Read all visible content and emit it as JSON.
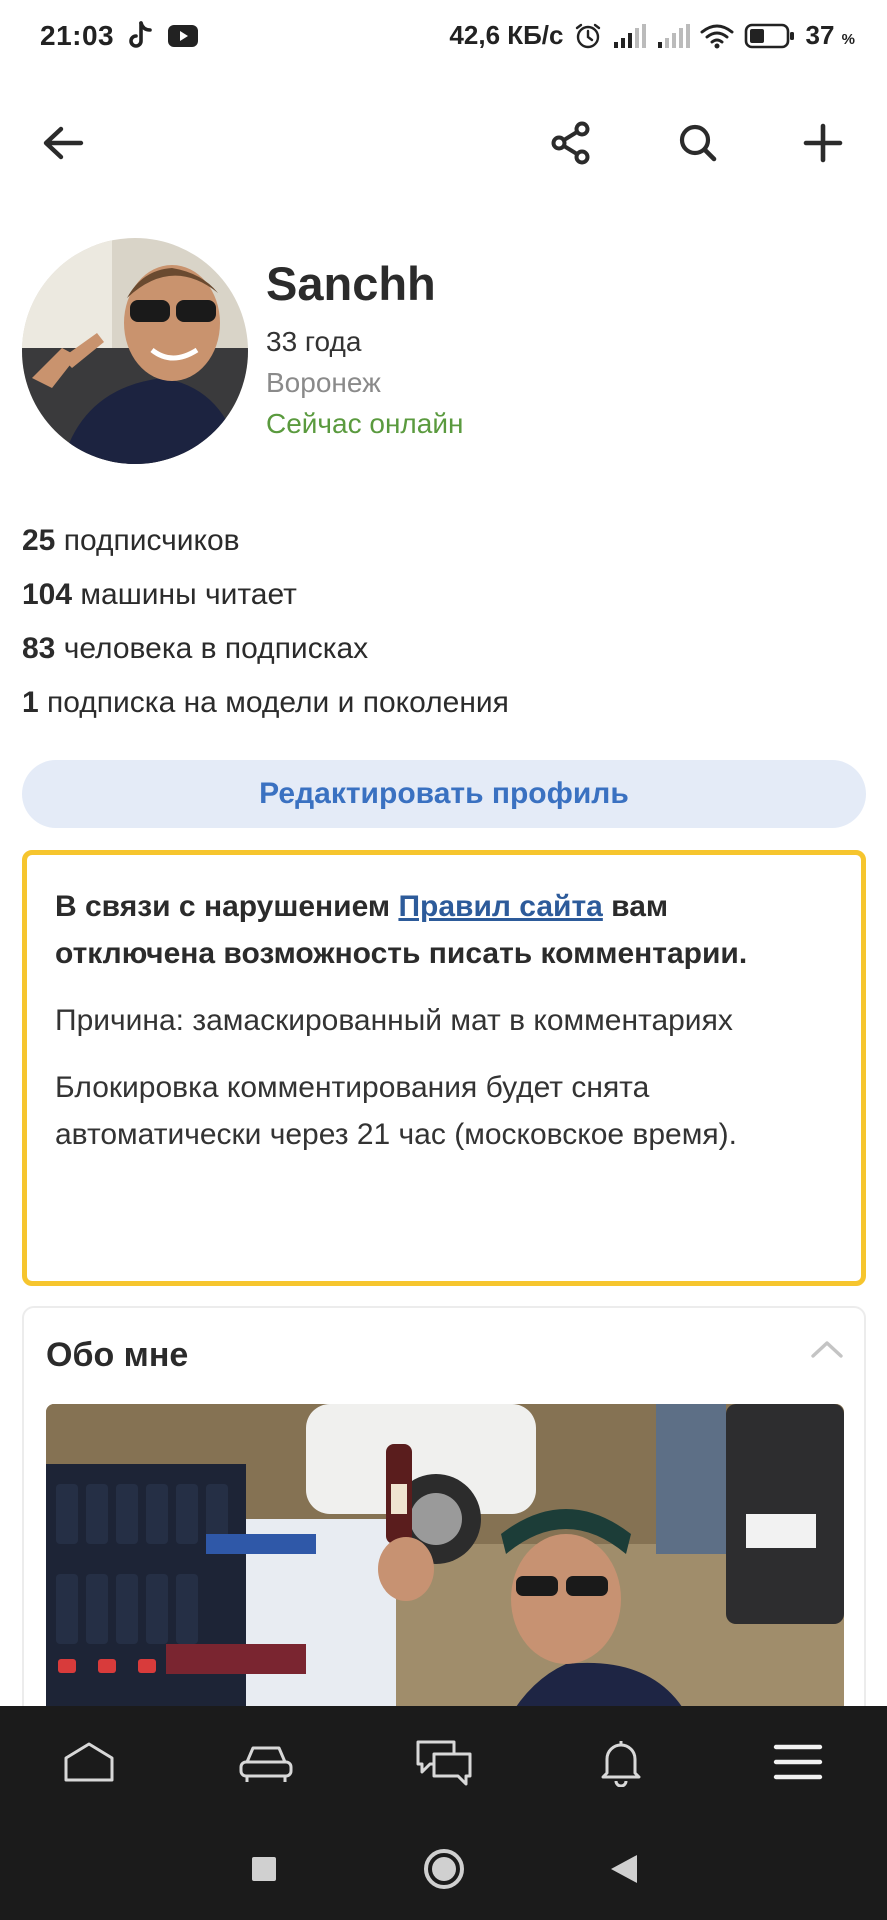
{
  "status_bar": {
    "time": "21:03",
    "net_speed": "42,6 КБ/с",
    "battery_percent": "37",
    "battery_unit": "%",
    "left_icons": [
      "tiktok-icon",
      "youtube-icon"
    ],
    "right_icons": [
      "alarm-icon",
      "signal-1-icon",
      "signal-2-icon",
      "wifi-icon",
      "battery-icon"
    ]
  },
  "app_bar": {
    "icons": [
      "back-arrow-icon",
      "share-icon",
      "search-icon",
      "plus-icon"
    ]
  },
  "profile": {
    "name": "Sanchh",
    "age": "33 года",
    "city": "Воронеж",
    "status": "Сейчас онлайн"
  },
  "stats": [
    {
      "count": "25",
      "label": " подписчиков"
    },
    {
      "count": "104",
      "label": " машины читает"
    },
    {
      "count": "83",
      "label": " человека в подписках"
    },
    {
      "count": "1",
      "label": " подписка на модели и поколения"
    }
  ],
  "edit_button": "Редактировать профиль",
  "warning": {
    "title_before": "В связи с нарушением ",
    "title_link": "Правил сайта",
    "title_after": " вам отключена возможность писать комментарии.",
    "reason": "Причина: замаскированный мат в комментариях",
    "unblock": "Блокировка комментирования будет снята автоматически через 21 час (московское время)."
  },
  "about": {
    "title": "Обо мне"
  },
  "bottom_nav": {
    "items": [
      "home-icon",
      "garage-car-icon",
      "messages-icon",
      "notifications-bell-icon",
      "menu-icon"
    ]
  },
  "system_nav": {
    "items": [
      "recents-square-icon",
      "home-circle-icon",
      "back-triangle-icon"
    ]
  },
  "colors": {
    "accent": "#3a71c1",
    "online": "#5a9a3e",
    "warning_border": "#f6c52e",
    "edit_button_bg": "#e4ebf7",
    "nav_bg": "#1b1b1b"
  }
}
